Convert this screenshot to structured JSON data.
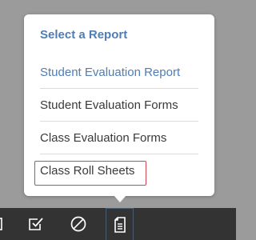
{
  "popover": {
    "title": "Select a Report",
    "items": [
      {
        "label": "Student Evaluation Report"
      },
      {
        "label": "Student Evaluation Forms"
      },
      {
        "label": "Class Evaluation Forms"
      },
      {
        "label": "Class Roll Sheets"
      }
    ]
  },
  "toolbar": {
    "tools": [
      {
        "icon": "partial-square-icon"
      },
      {
        "icon": "checkbox-check-icon"
      },
      {
        "icon": "no-symbol-icon"
      },
      {
        "icon": "document-icon",
        "active": true
      }
    ]
  },
  "colors": {
    "backdrop": "#9b9b9b",
    "accent": "#4f7db4",
    "highlight": "#d2444e",
    "toolbar": "#333333"
  }
}
